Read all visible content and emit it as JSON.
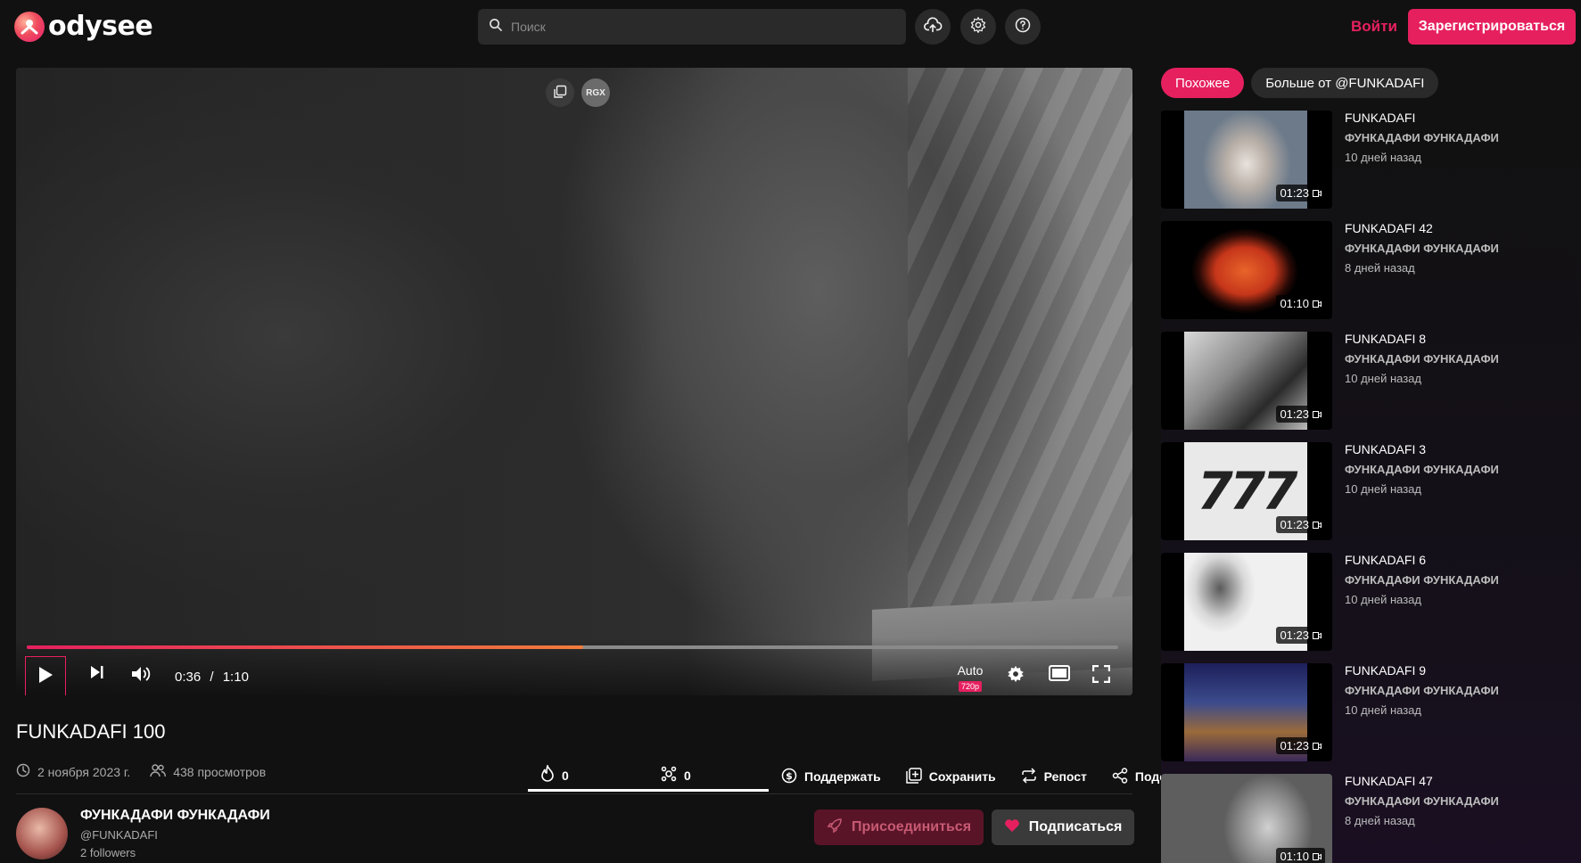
{
  "header": {
    "logo_text": "odysee",
    "search_placeholder": "Поиск",
    "login_label": "Войти",
    "signup_label": "Зарегистрироваться"
  },
  "player": {
    "badge_text": "RGX",
    "current_time": "0:36",
    "time_separator": "/",
    "duration": "1:10",
    "progress": 0.51,
    "quality_label": "Auto",
    "quality_badge": "720p"
  },
  "video": {
    "title": "FUNKADAFI 100",
    "date": "2 ноября 2023 г.",
    "views": "438 просмотров",
    "fire_count": "0",
    "slime_count": "0",
    "support_label": "Поддержать",
    "save_label": "Сохранить",
    "repost_label": "Репост",
    "share_label": "Поделиться"
  },
  "channel": {
    "name": "ФУНКАДАФИ ФУНКАДАФИ",
    "handle": "@FUNKADAFI",
    "followers": "2 followers",
    "join_label": "Присоединиться",
    "subscribe_label": "Подписаться"
  },
  "sidebar": {
    "tabs": [
      "Похожее",
      "Больше от @FUNKADAFI"
    ],
    "items": [
      {
        "title": "FUNKADAFI",
        "channel": "ФУНКАДАФИ ФУНКАДАФИ",
        "date": "10 дней назад",
        "duration": "01:23"
      },
      {
        "title": "FUNKADAFI 42",
        "channel": "ФУНКАДАФИ ФУНКАДАФИ",
        "date": "8 дней назад",
        "duration": "01:10"
      },
      {
        "title": "FUNKADAFI 8",
        "channel": "ФУНКАДАФИ ФУНКАДАФИ",
        "date": "10 дней назад",
        "duration": "01:23"
      },
      {
        "title": "FUNKADAFI 3",
        "channel": "ФУНКАДАФИ ФУНКАДАФИ",
        "date": "10 дней назад",
        "duration": "01:23"
      },
      {
        "title": "FUNKADAFI 6",
        "channel": "ФУНКАДАФИ ФУНКАДАФИ",
        "date": "10 дней назад",
        "duration": "01:23"
      },
      {
        "title": "FUNKADAFI 9",
        "channel": "ФУНКАДАФИ ФУНКАДАФИ",
        "date": "10 дней назад",
        "duration": "01:23"
      },
      {
        "title": "FUNKADAFI 47",
        "channel": "ФУНКАДАФИ ФУНКАДАФИ",
        "date": "8 дней назад",
        "duration": "01:10"
      }
    ],
    "thumb_777_text": "777"
  },
  "colors": {
    "accent": "#e6205f",
    "background": "#111111",
    "surface": "#2a2a2a"
  }
}
